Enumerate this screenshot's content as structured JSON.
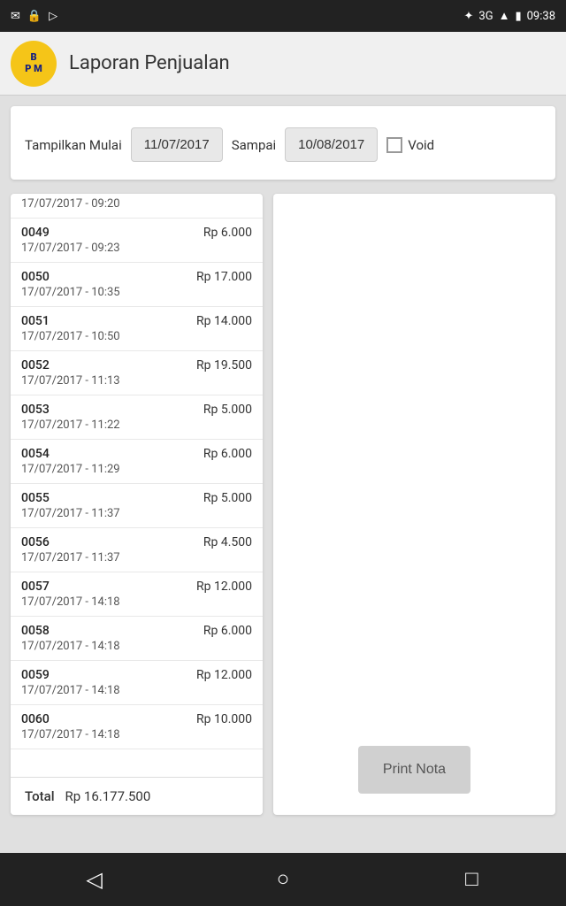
{
  "statusBar": {
    "time": "09:38",
    "network": "3G",
    "batteryIcon": "🔋"
  },
  "header": {
    "title": "Laporan Penjualan",
    "logoLine1": "B",
    "logoLine2": "P M"
  },
  "filter": {
    "tampilkanLabel": "Tampilkan Mulai",
    "dateFrom": "11/07/2017",
    "sampaiLabel": "Sampai",
    "dateTo": "10/08/2017",
    "voidLabel": "Void"
  },
  "listItems": [
    {
      "number": "0049",
      "amount": "Rp 6.000",
      "datetime": "17/07/2017 - 09:23"
    },
    {
      "number": "0050",
      "amount": "Rp 17.000",
      "datetime": "17/07/2017 - 10:35"
    },
    {
      "number": "0051",
      "amount": "Rp 14.000",
      "datetime": "17/07/2017 - 10:50"
    },
    {
      "number": "0052",
      "amount": "Rp 19.500",
      "datetime": "17/07/2017 - 11:13"
    },
    {
      "number": "0053",
      "amount": "Rp 5.000",
      "datetime": "17/07/2017 - 11:22"
    },
    {
      "number": "0054",
      "amount": "Rp 6.000",
      "datetime": "17/07/2017 - 11:29"
    },
    {
      "number": "0055",
      "amount": "Rp 5.000",
      "datetime": "17/07/2017 - 11:37"
    },
    {
      "number": "0056",
      "amount": "Rp 4.500",
      "datetime": "17/07/2017 - 11:37"
    },
    {
      "number": "0057",
      "amount": "Rp 12.000",
      "datetime": "17/07/2017 - 14:18"
    },
    {
      "number": "0058",
      "amount": "Rp 6.000",
      "datetime": "17/07/2017 - 14:18"
    },
    {
      "number": "0059",
      "amount": "Rp 12.000",
      "datetime": "17/07/2017 - 14:18"
    },
    {
      "number": "0060",
      "amount": "Rp 10.000",
      "datetime": "17/07/2017 - 14:18"
    }
  ],
  "partialItem": {
    "datetime": "17/07/2017 - 09:20"
  },
  "footer": {
    "totalLabel": "Total",
    "totalAmount": "Rp 16.177.500"
  },
  "printButton": {
    "label": "Print Nota"
  },
  "bottomNav": {
    "backIcon": "◁",
    "homeIcon": "○",
    "recentIcon": "□"
  }
}
